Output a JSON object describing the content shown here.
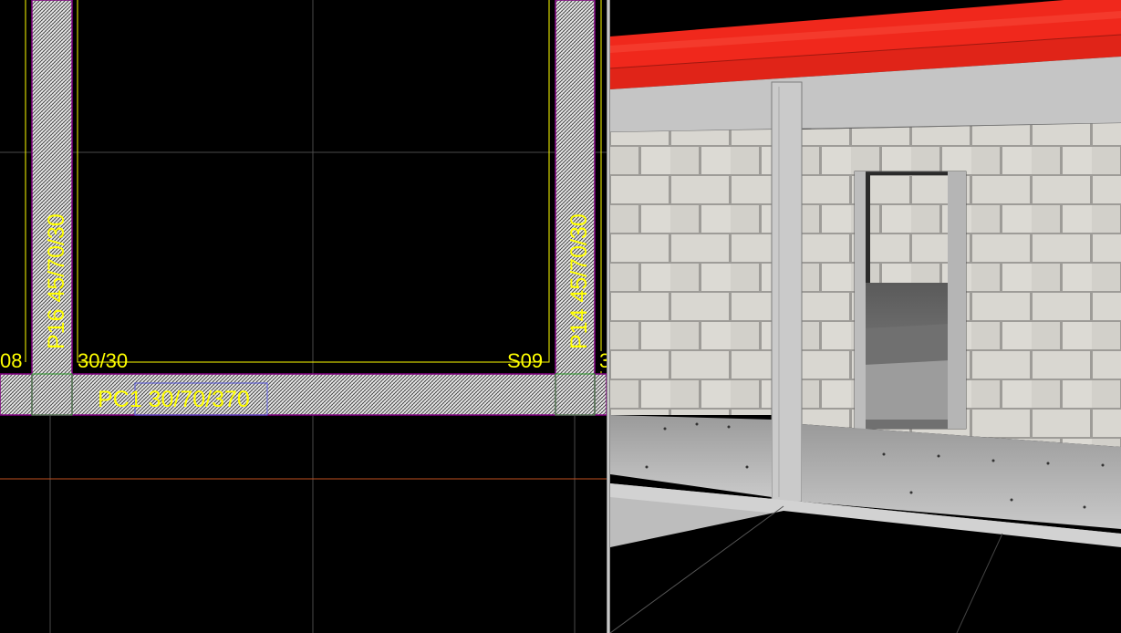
{
  "cad": {
    "labels": {
      "beam_bottom": "PC1 30/70/370",
      "column_left": "P16 45/70/30",
      "column_right": "P14 45/70/30",
      "section_left": "30/30",
      "edge_left": "08",
      "slab_right": "S09"
    },
    "colors": {
      "background": "#000000",
      "text": "#ffff00",
      "slab_outline": "#ffff00",
      "hatch_outline": "#800080",
      "grid": "#4a4a4a",
      "axis_orange": "#c05020",
      "guide_green": "#2fa02f"
    }
  },
  "view3d": {
    "colors": {
      "roof": "#f0281c",
      "wall_block": "#d8d6d0",
      "mortar": "#9e9c98",
      "concrete": "#c7c7c7",
      "floor": "#000000"
    }
  }
}
